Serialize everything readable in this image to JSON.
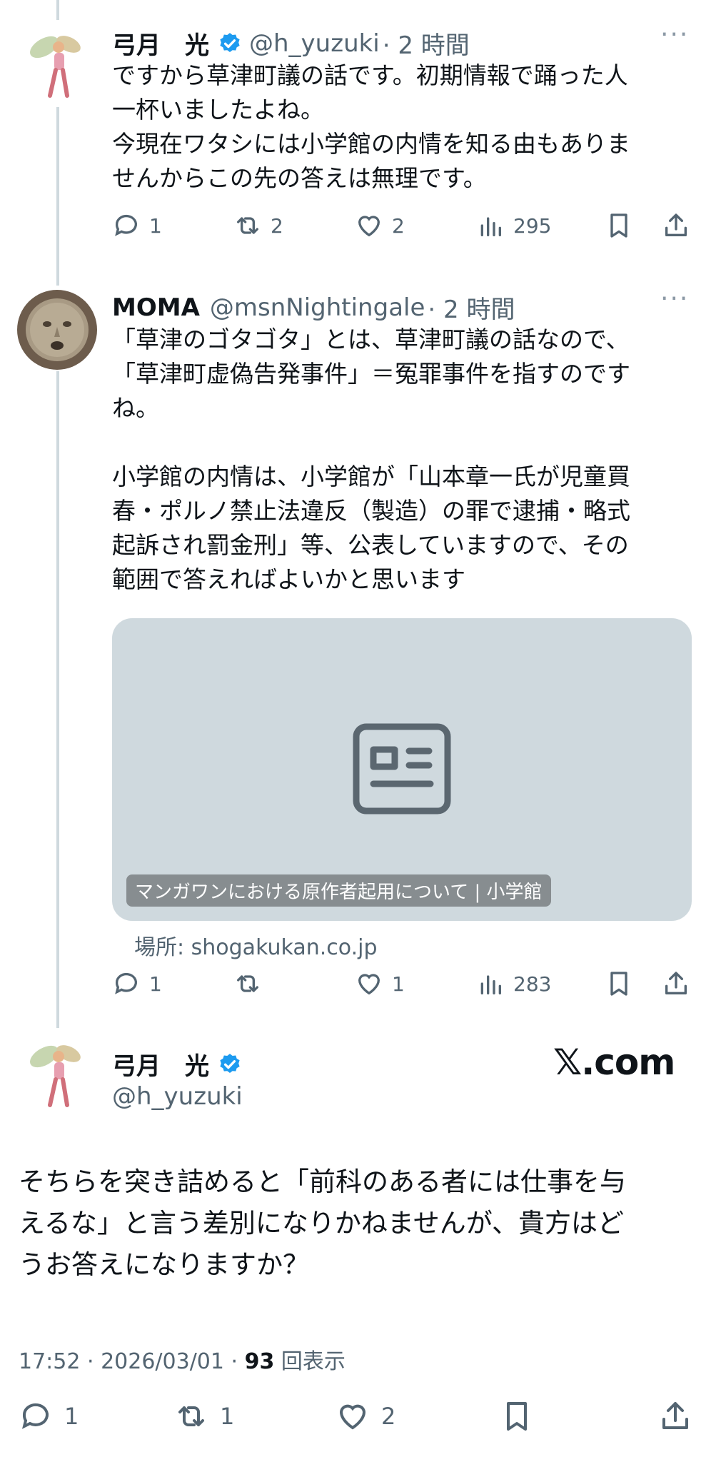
{
  "tweet1": {
    "name": "弓月　光",
    "handle": "@h_yuzuki",
    "time": "· 2 時間",
    "text": "ですから草津町議の話です。初期情報で踊った人\n一杯いましたよね。\n今現在ワタシには小学館の内情を知る由もありま\nせんからこの先の答えは無理です。",
    "replies": "1",
    "reposts": "2",
    "likes": "2",
    "views": "295"
  },
  "tweet2": {
    "name": "MOMA",
    "handle": "@msnNightingale",
    "time": "· 2 時間",
    "text": "「草津のゴタゴタ」とは、草津町議の話なので、\n「草津町虚偽告発事件」＝冤罪事件を指すのです\nね。\n\n小学館の内情は、小学館が「山本章一氏が児童買\n春・ポルノ禁止法違反（製造）の罪で逮捕・略式\n起訴され罰金刑」等、公表していますので、その\n範囲で答えればよいかと思います",
    "card_title": "マンガワンにおける原作者起用について | 小学館",
    "card_source": "場所: shogakukan.co.jp",
    "replies": "1",
    "reposts": "",
    "likes": "1",
    "views": "283"
  },
  "main_tweet": {
    "name": "弓月　光",
    "handle": "@h_yuzuki",
    "brand": "𝕏.com",
    "text": "そちらを突き詰めると「前科のある者には仕事を与\nえるな」と言う差別になりかねませんが、貴方はど\nうお答えになりますか？",
    "time_date": "17:52 · 2026/03/01 · ",
    "views_count": "93",
    "views_label": " 回表示",
    "replies": "1",
    "reposts": "1",
    "likes": "2"
  },
  "icons": [
    "more-icon",
    "verified-icon",
    "reply-icon",
    "repost-icon",
    "like-icon",
    "views-icon",
    "bookmark-icon",
    "share-icon",
    "article-icon"
  ],
  "colors": {
    "verified": "#1d9bf0",
    "muted": "#536471",
    "thread": "#cfd9de",
    "card": "#cfd9de"
  }
}
